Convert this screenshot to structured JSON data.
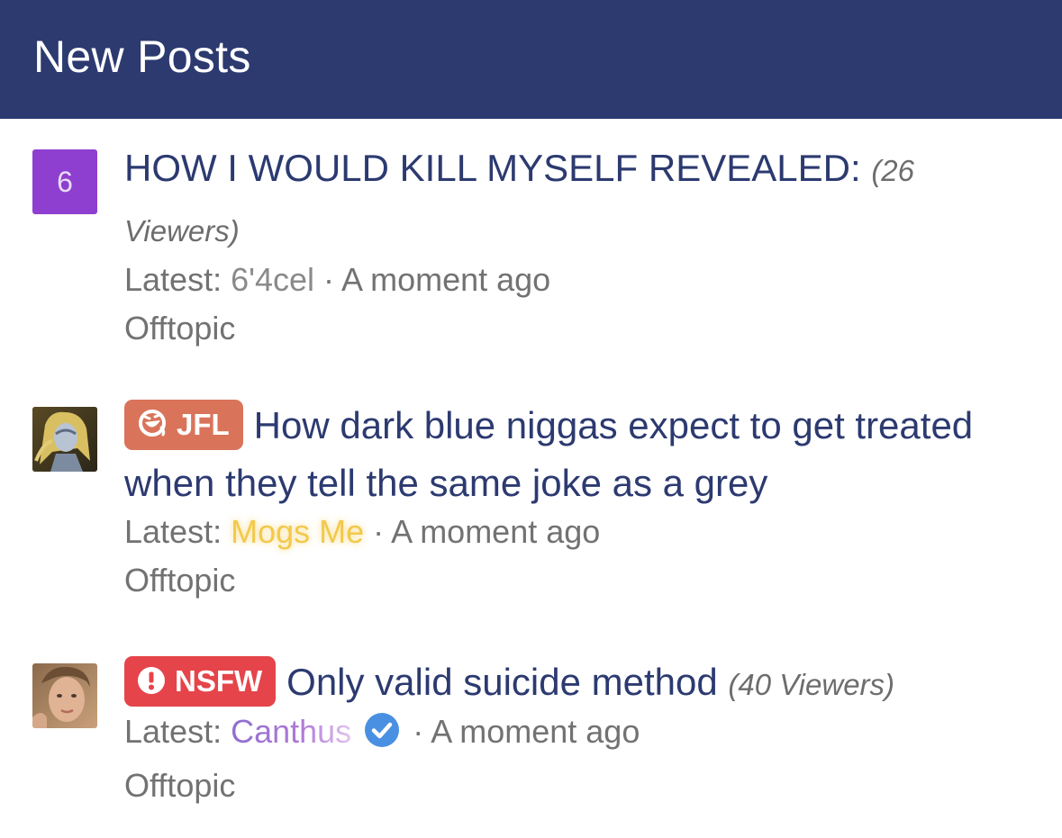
{
  "header": {
    "title": "New Posts"
  },
  "posts": [
    {
      "avatar_letter": "6",
      "title": "HOW I WOULD KILL MYSELF REVEALED:",
      "viewers": "(26 Viewers)",
      "latest_label": "Latest:",
      "latest_user": "6'4cel",
      "time": "· A moment ago",
      "forum": "Offtopic"
    },
    {
      "prefix": "JFL",
      "title": "How dark blue niggas expect to get treated when they tell the same joke as a grey",
      "latest_label": "Latest:",
      "latest_user": "Mogs Me",
      "time": "· A moment ago",
      "forum": "Offtopic"
    },
    {
      "prefix": "NSFW",
      "title": "Only valid suicide method",
      "viewers": "(40 Viewers)",
      "latest_label": "Latest:",
      "latest_user": "Canthus",
      "time": "· A moment ago",
      "forum": "Offtopic"
    }
  ],
  "colors": {
    "header_bg": "#2c3a70",
    "title": "#2c3a70",
    "jfl_prefix": "#d9745b",
    "nsfw_prefix": "#e5444a",
    "letter_avatar": "#8e3fd0",
    "verified": "#4a90e2"
  },
  "icons": {
    "jfl": "laughing-face-icon",
    "nsfw": "exclamation-circle-icon",
    "verified": "verified-check-icon"
  }
}
